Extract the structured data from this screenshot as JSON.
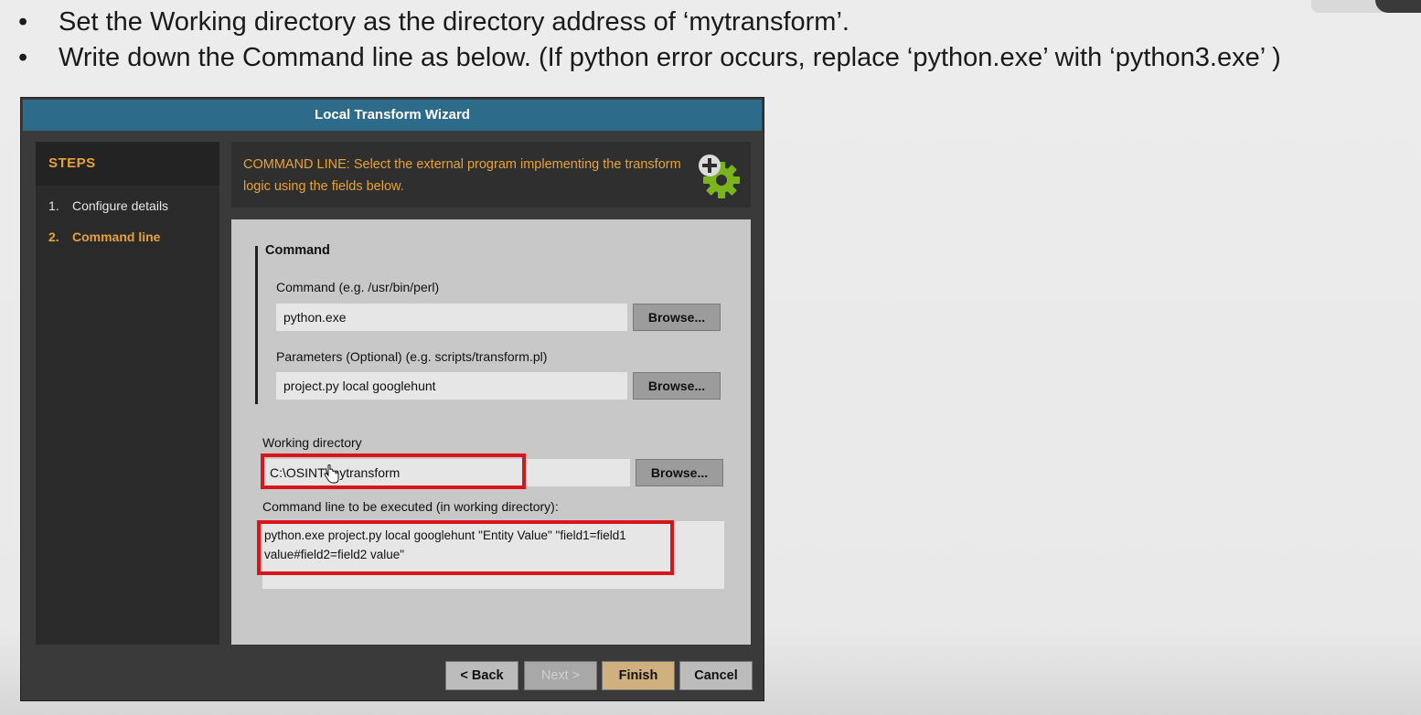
{
  "slide": {
    "bullet_glyph": "•",
    "bullets": [
      "Set the Working directory as the directory address of ‘mytransform’.",
      "Write down the Command line as below. (If python error occurs, replace ‘python.exe’ with ‘python3.exe’ )"
    ]
  },
  "wizard": {
    "title": "Local Transform Wizard",
    "steps_title": "STEPS",
    "steps": [
      {
        "num": "1.",
        "label": "Configure details"
      },
      {
        "num": "2.",
        "label": "Command line"
      }
    ],
    "header_description": "COMMAND LINE: Select the external program implementing the transform logic using the fields below.",
    "header_icon": "add-gear-icon",
    "command_group_title": "Command",
    "command_label": "Command (e.g. /usr/bin/perl)",
    "command_value": "python.exe",
    "params_label": "Parameters (Optional) (e.g. scripts/transform.pl)",
    "params_value": "project.py local googlehunt",
    "browse_label": "Browse...",
    "working_dir_label": "Working directory",
    "working_dir_value": "C:\\OSINT\\mytransform",
    "exec_label": "Command line to be executed (in working directory):",
    "exec_value": "python.exe project.py local googlehunt \"Entity Value\" \"field1=field1 value#field2=field2 value\"",
    "buttons": {
      "back_label": "< Back",
      "next_label": "Next >",
      "finish_label": "Finish",
      "cancel_label": "Cancel"
    },
    "accent_color": "#e8a23a",
    "title_bar_color": "#2e6b8a",
    "highlight_color": "#d7161b"
  }
}
